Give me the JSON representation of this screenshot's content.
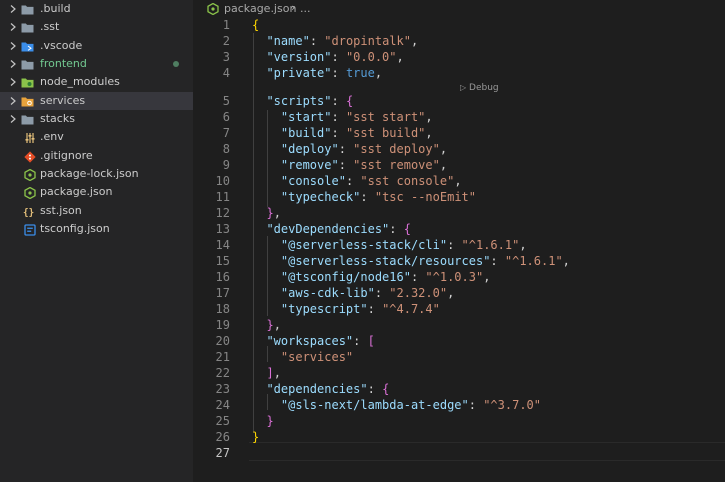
{
  "explorer": {
    "items": [
      {
        "label": ".build",
        "type": "folder",
        "icon": "folder-icon",
        "expandable": true,
        "label_color": "#cccccc",
        "icon_color": "#8d9ba8"
      },
      {
        "label": ".sst",
        "type": "folder",
        "icon": "folder-icon",
        "expandable": true,
        "label_color": "#cccccc",
        "icon_color": "#8d9ba8"
      },
      {
        "label": ".vscode",
        "type": "folder",
        "icon": "vscode-folder-icon",
        "expandable": true,
        "label_color": "#cccccc",
        "icon_color": "#3b8eea"
      },
      {
        "label": "frontend",
        "type": "folder",
        "icon": "folder-icon",
        "expandable": true,
        "label_color": "#73c991",
        "icon_color": "#8d9ba8",
        "modified": true
      },
      {
        "label": "node_modules",
        "type": "folder",
        "icon": "node-folder-icon",
        "expandable": true,
        "label_color": "#cccccc",
        "icon_color": "#8bc34a"
      },
      {
        "label": "services",
        "type": "folder",
        "icon": "services-folder-icon",
        "expandable": true,
        "label_color": "#cccccc",
        "icon_color": "#e8a33c",
        "selected": true
      },
      {
        "label": "stacks",
        "type": "folder",
        "icon": "folder-icon",
        "expandable": true,
        "label_color": "#cccccc",
        "icon_color": "#8d9ba8"
      },
      {
        "label": ".env",
        "type": "file",
        "icon": "settings-file-icon",
        "expandable": false,
        "label_color": "#cccccc",
        "icon_color": "#e5c07b"
      },
      {
        "label": ".gitignore",
        "type": "file",
        "icon": "git-icon",
        "expandable": false,
        "label_color": "#cccccc",
        "icon_color": "#e44d26"
      },
      {
        "label": "package-lock.json",
        "type": "file",
        "icon": "nodejs-icon",
        "expandable": false,
        "label_color": "#cccccc",
        "icon_color": "#8bc34a"
      },
      {
        "label": "package.json",
        "type": "file",
        "icon": "nodejs-icon",
        "expandable": false,
        "label_color": "#cccccc",
        "icon_color": "#8bc34a"
      },
      {
        "label": "sst.json",
        "type": "file",
        "icon": "json-icon",
        "expandable": false,
        "label_color": "#cccccc",
        "icon_color": "#e5c07b"
      },
      {
        "label": "tsconfig.json",
        "type": "file",
        "icon": "tsconfig-icon",
        "expandable": false,
        "label_color": "#cccccc",
        "icon_color": "#3b8eea"
      }
    ]
  },
  "breadcrumb": {
    "file": "package.json",
    "separator": "›",
    "ellipsis": "..."
  },
  "codelens": {
    "label": "Debug",
    "icon": "play-icon"
  },
  "editor": {
    "active_line": 27,
    "lines": [
      {
        "n": "1",
        "tokens": [
          {
            "t": "{",
            "c": "b1"
          }
        ]
      },
      {
        "n": "2",
        "tokens": [
          {
            "t": "  ",
            "c": "p"
          },
          {
            "t": "\"name\"",
            "c": "key"
          },
          {
            "t": ": ",
            "c": "p"
          },
          {
            "t": "\"dropintalk\"",
            "c": "str"
          },
          {
            "t": ",",
            "c": "p"
          }
        ]
      },
      {
        "n": "3",
        "tokens": [
          {
            "t": "  ",
            "c": "p"
          },
          {
            "t": "\"version\"",
            "c": "key"
          },
          {
            "t": ": ",
            "c": "p"
          },
          {
            "t": "\"0.0.0\"",
            "c": "str"
          },
          {
            "t": ",",
            "c": "p"
          }
        ]
      },
      {
        "n": "4",
        "tokens": [
          {
            "t": "  ",
            "c": "p"
          },
          {
            "t": "\"private\"",
            "c": "key"
          },
          {
            "t": ": ",
            "c": "p"
          },
          {
            "t": "true",
            "c": "kw"
          },
          {
            "t": ",",
            "c": "p"
          }
        ]
      },
      {
        "n": "5",
        "tokens": [
          {
            "t": "  ",
            "c": "p"
          },
          {
            "t": "\"scripts\"",
            "c": "key"
          },
          {
            "t": ": ",
            "c": "p"
          },
          {
            "t": "{",
            "c": "b2"
          }
        ]
      },
      {
        "n": "6",
        "tokens": [
          {
            "t": "    ",
            "c": "p"
          },
          {
            "t": "\"start\"",
            "c": "key"
          },
          {
            "t": ": ",
            "c": "p"
          },
          {
            "t": "\"sst start\"",
            "c": "str"
          },
          {
            "t": ",",
            "c": "p"
          }
        ]
      },
      {
        "n": "7",
        "tokens": [
          {
            "t": "    ",
            "c": "p"
          },
          {
            "t": "\"build\"",
            "c": "key"
          },
          {
            "t": ": ",
            "c": "p"
          },
          {
            "t": "\"sst build\"",
            "c": "str"
          },
          {
            "t": ",",
            "c": "p"
          }
        ]
      },
      {
        "n": "8",
        "tokens": [
          {
            "t": "    ",
            "c": "p"
          },
          {
            "t": "\"deploy\"",
            "c": "key"
          },
          {
            "t": ": ",
            "c": "p"
          },
          {
            "t": "\"sst deploy\"",
            "c": "str"
          },
          {
            "t": ",",
            "c": "p"
          }
        ]
      },
      {
        "n": "9",
        "tokens": [
          {
            "t": "    ",
            "c": "p"
          },
          {
            "t": "\"remove\"",
            "c": "key"
          },
          {
            "t": ": ",
            "c": "p"
          },
          {
            "t": "\"sst remove\"",
            "c": "str"
          },
          {
            "t": ",",
            "c": "p"
          }
        ]
      },
      {
        "n": "10",
        "tokens": [
          {
            "t": "    ",
            "c": "p"
          },
          {
            "t": "\"console\"",
            "c": "key"
          },
          {
            "t": ": ",
            "c": "p"
          },
          {
            "t": "\"sst console\"",
            "c": "str"
          },
          {
            "t": ",",
            "c": "p"
          }
        ]
      },
      {
        "n": "11",
        "tokens": [
          {
            "t": "    ",
            "c": "p"
          },
          {
            "t": "\"typecheck\"",
            "c": "key"
          },
          {
            "t": ": ",
            "c": "p"
          },
          {
            "t": "\"tsc --noEmit\"",
            "c": "str"
          }
        ]
      },
      {
        "n": "12",
        "tokens": [
          {
            "t": "  ",
            "c": "p"
          },
          {
            "t": "}",
            "c": "b2"
          },
          {
            "t": ",",
            "c": "p"
          }
        ]
      },
      {
        "n": "13",
        "tokens": [
          {
            "t": "  ",
            "c": "p"
          },
          {
            "t": "\"devDependencies\"",
            "c": "key"
          },
          {
            "t": ": ",
            "c": "p"
          },
          {
            "t": "{",
            "c": "b2"
          }
        ]
      },
      {
        "n": "14",
        "tokens": [
          {
            "t": "    ",
            "c": "p"
          },
          {
            "t": "\"@serverless-stack/cli\"",
            "c": "key"
          },
          {
            "t": ": ",
            "c": "p"
          },
          {
            "t": "\"^1.6.1\"",
            "c": "str"
          },
          {
            "t": ",",
            "c": "p"
          }
        ]
      },
      {
        "n": "15",
        "tokens": [
          {
            "t": "    ",
            "c": "p"
          },
          {
            "t": "\"@serverless-stack/resources\"",
            "c": "key"
          },
          {
            "t": ": ",
            "c": "p"
          },
          {
            "t": "\"^1.6.1\"",
            "c": "str"
          },
          {
            "t": ",",
            "c": "p"
          }
        ]
      },
      {
        "n": "16",
        "tokens": [
          {
            "t": "    ",
            "c": "p"
          },
          {
            "t": "\"@tsconfig/node16\"",
            "c": "key"
          },
          {
            "t": ": ",
            "c": "p"
          },
          {
            "t": "\"^1.0.3\"",
            "c": "str"
          },
          {
            "t": ",",
            "c": "p"
          }
        ]
      },
      {
        "n": "17",
        "tokens": [
          {
            "t": "    ",
            "c": "p"
          },
          {
            "t": "\"aws-cdk-lib\"",
            "c": "key"
          },
          {
            "t": ": ",
            "c": "p"
          },
          {
            "t": "\"2.32.0\"",
            "c": "str"
          },
          {
            "t": ",",
            "c": "p"
          }
        ]
      },
      {
        "n": "18",
        "tokens": [
          {
            "t": "    ",
            "c": "p"
          },
          {
            "t": "\"typescript\"",
            "c": "key"
          },
          {
            "t": ": ",
            "c": "p"
          },
          {
            "t": "\"^4.7.4\"",
            "c": "str"
          }
        ]
      },
      {
        "n": "19",
        "tokens": [
          {
            "t": "  ",
            "c": "p"
          },
          {
            "t": "}",
            "c": "b2"
          },
          {
            "t": ",",
            "c": "p"
          }
        ]
      },
      {
        "n": "20",
        "tokens": [
          {
            "t": "  ",
            "c": "p"
          },
          {
            "t": "\"workspaces\"",
            "c": "key"
          },
          {
            "t": ": ",
            "c": "p"
          },
          {
            "t": "[",
            "c": "b2"
          }
        ]
      },
      {
        "n": "21",
        "tokens": [
          {
            "t": "    ",
            "c": "p"
          },
          {
            "t": "\"services\"",
            "c": "str"
          }
        ]
      },
      {
        "n": "22",
        "tokens": [
          {
            "t": "  ",
            "c": "p"
          },
          {
            "t": "]",
            "c": "b2"
          },
          {
            "t": ",",
            "c": "p"
          }
        ]
      },
      {
        "n": "23",
        "tokens": [
          {
            "t": "  ",
            "c": "p"
          },
          {
            "t": "\"dependencies\"",
            "c": "key"
          },
          {
            "t": ": ",
            "c": "p"
          },
          {
            "t": "{",
            "c": "b2"
          }
        ]
      },
      {
        "n": "24",
        "tokens": [
          {
            "t": "    ",
            "c": "p"
          },
          {
            "t": "\"@sls-next/lambda-at-edge\"",
            "c": "key"
          },
          {
            "t": ": ",
            "c": "p"
          },
          {
            "t": "\"^3.7.0\"",
            "c": "str"
          }
        ]
      },
      {
        "n": "25",
        "tokens": [
          {
            "t": "  ",
            "c": "p"
          },
          {
            "t": "}",
            "c": "b2"
          }
        ]
      },
      {
        "n": "26",
        "tokens": [
          {
            "t": "}",
            "c": "b1"
          }
        ]
      },
      {
        "n": "27",
        "tokens": []
      }
    ]
  },
  "colors": {
    "sidebar_bg": "#252526",
    "editor_bg": "#1e1e1e",
    "selected_row": "#37373d",
    "json_key": "#9cdcfe",
    "json_string": "#ce9178",
    "json_keyword": "#569cd6",
    "bracket_level1": "#ffd700",
    "bracket_level2": "#da70d6",
    "git_modified": "#73c991"
  }
}
